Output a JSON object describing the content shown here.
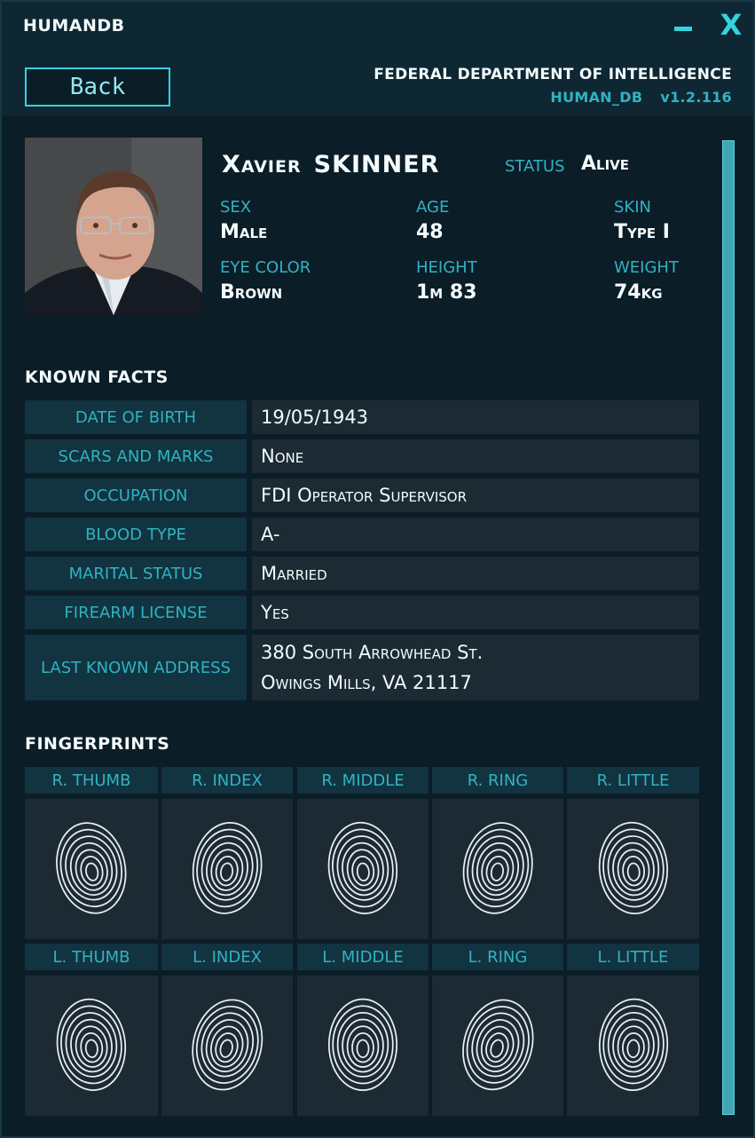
{
  "window": {
    "title": "HUMANDB",
    "minimize_icon": "minimize-icon",
    "close_label": "X"
  },
  "header": {
    "back_label": "Back",
    "agency": "FEDERAL DEPARTMENT OF INTELLIGENCE",
    "app_name": "HUMAN_DB",
    "version": "v1.2.116"
  },
  "profile": {
    "first_name": "Xavier",
    "last_name": "SKINNER",
    "status_label": "STATUS",
    "status_value": "Alive",
    "attributes": [
      {
        "label": "SEX",
        "value": "Male"
      },
      {
        "label": "AGE",
        "value": "48"
      },
      {
        "label": "SKIN",
        "value": "Type I"
      },
      {
        "label": "EYE COLOR",
        "value": "Brown"
      },
      {
        "label": "HEIGHT",
        "value": "1m 83"
      },
      {
        "label": "WEIGHT",
        "value": "74kg"
      }
    ]
  },
  "facts": {
    "title": "KNOWN  FACTS",
    "rows": [
      {
        "key": "DATE OF BIRTH",
        "lines": [
          "19/05/1943"
        ]
      },
      {
        "key": "SCARS AND MARKS",
        "lines": [
          "None"
        ]
      },
      {
        "key": "OCCUPATION",
        "lines": [
          "FDI Operator Supervisor"
        ]
      },
      {
        "key": "BLOOD TYPE",
        "lines": [
          "A-"
        ]
      },
      {
        "key": "MARITAL STATUS",
        "lines": [
          "Married"
        ]
      },
      {
        "key": "FIREARM LICENSE",
        "lines": [
          "Yes"
        ]
      },
      {
        "key": "LAST KNOWN ADDRESS",
        "lines": [
          "380 South Arrowhead St.",
          "Owings Mills, VA 21117"
        ]
      }
    ]
  },
  "fingerprints": {
    "title": "FINGERPRINTS",
    "right": [
      "R. THUMB",
      "R. INDEX",
      "R. MIDDLE",
      "R. RING",
      "R. LITTLE"
    ],
    "left": [
      "L. THUMB",
      "L. INDEX",
      "L. MIDDLE",
      "L. RING",
      "L. LITTLE"
    ]
  },
  "colors": {
    "accent": "#35d3e0",
    "label": "#2fb3c2",
    "panel": "#123340",
    "value_bg": "#1b2a33"
  }
}
